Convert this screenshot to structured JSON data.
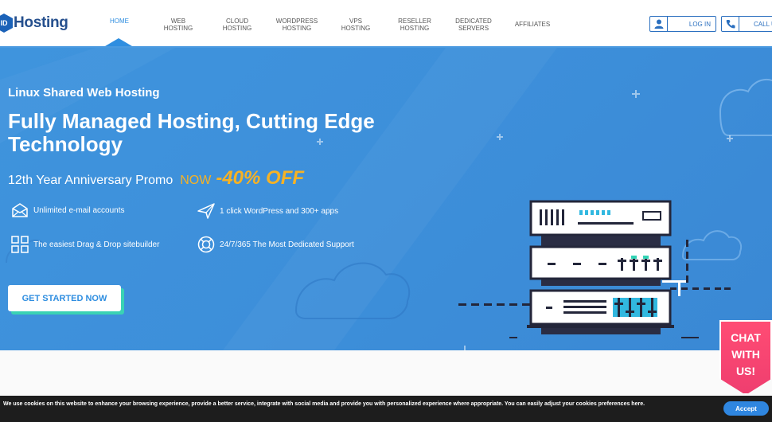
{
  "header": {
    "logo_badge": "ID",
    "logo_text": "Hosting",
    "nav": [
      {
        "label": "HOME",
        "active": true
      },
      {
        "label": "WEB HOSTING"
      },
      {
        "label": "CLOUD HOSTING"
      },
      {
        "label": "WORDPRESS HOSTING"
      },
      {
        "label": "VPS HOSTING"
      },
      {
        "label": "RESELLER HOSTING"
      },
      {
        "label": "DEDICATED SERVERS"
      },
      {
        "label": "AFFILIATES"
      }
    ],
    "login_label": "LOG IN",
    "call_label": "CALL U"
  },
  "hero": {
    "subtitle": "Linux Shared Web Hosting",
    "title": "Fully Managed Hosting, Cutting Edge Technology",
    "promo_text": "12th Year Anniversary Promo",
    "promo_now": "NOW",
    "promo_off": "-40% OFF",
    "features": [
      {
        "icon": "email-icon",
        "label": "Unlimited e-mail accounts"
      },
      {
        "icon": "paper-plane-icon",
        "label": "1 click WordPress and 300+ apps"
      },
      {
        "icon": "grid-icon",
        "label": "The easiest Drag & Drop sitebuilder"
      },
      {
        "icon": "lifebuoy-icon",
        "label": "24/7/365 The Most Dedicated Support"
      }
    ],
    "cta_label": "GET STARTED NOW"
  },
  "cookie": {
    "text": "We use cookies on this website to enhance your browsing experience, provide a better service, integrate with social media and provide you with personalized experience where appropriate. You can easily adjust your cookies preferences here.",
    "accept_label": "Accept"
  },
  "chat": {
    "label": "CHAT WITH US!"
  },
  "colors": {
    "primary": "#2f8ee0",
    "hero_bg": "#3d8fda",
    "promo_accent": "#f6b225",
    "cta_shadow": "#3ad2b4",
    "chat_bg": "#ef3e6f",
    "cookie_bg": "#1d1d1d"
  }
}
